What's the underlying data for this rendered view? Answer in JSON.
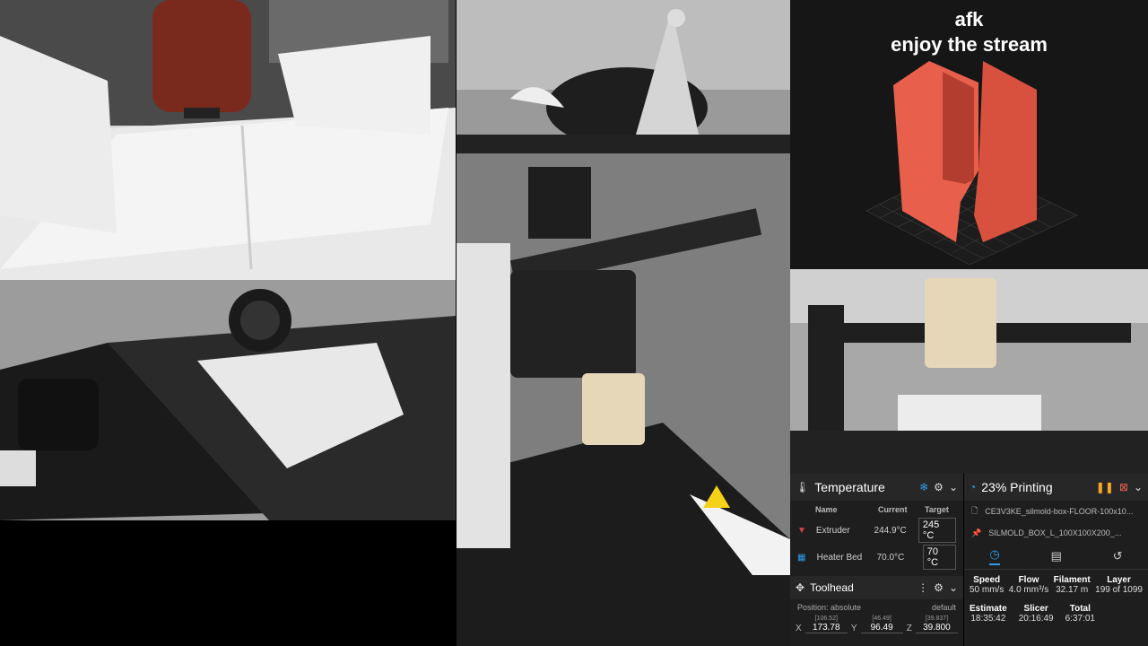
{
  "stream": {
    "line1": "afk",
    "line2": "enjoy the stream"
  },
  "temperature": {
    "title": "Temperature",
    "headers": {
      "name": "Name",
      "current": "Current",
      "target": "Target"
    },
    "rows": [
      {
        "name": "Extruder",
        "current": "244.9°C",
        "target": "245",
        "unit": "°C"
      },
      {
        "name": "Heater Bed",
        "current": "70.0°C",
        "target": "70",
        "unit": "°C"
      }
    ]
  },
  "toolhead": {
    "title": "Toolhead",
    "position": "Position: absolute",
    "mode": "default",
    "x": {
      "label": "X",
      "value": "173.78",
      "sub": "[106.52]"
    },
    "y": {
      "label": "Y",
      "value": "96.49",
      "sub": "[46.49]"
    },
    "z": {
      "label": "Z",
      "value": "39.800",
      "sub": "[39.837]"
    }
  },
  "status": {
    "title": "23% Printing",
    "file1": "CE3V3KE_silmold-box-FLOOR-100x10...",
    "file2": "SILMOLD_BOX_L_100X100X200_...",
    "stats": [
      {
        "h": "Speed",
        "v": "50 mm/s"
      },
      {
        "h": "Flow",
        "v": "4.0 mm³/s"
      },
      {
        "h": "Filament",
        "v": "32.17 m"
      },
      {
        "h": "Layer",
        "v": "199 of 1099"
      }
    ],
    "times": [
      {
        "h": "Estimate",
        "v": "18:35:42"
      },
      {
        "h": "Slicer",
        "v": "20:16:49"
      },
      {
        "h": "Total",
        "v": "6:37:01"
      }
    ]
  },
  "colors": {
    "accent": "#2e9ce6",
    "preview_model": "#e8604c",
    "pause": "#f5a623",
    "hotend": "#d44"
  }
}
